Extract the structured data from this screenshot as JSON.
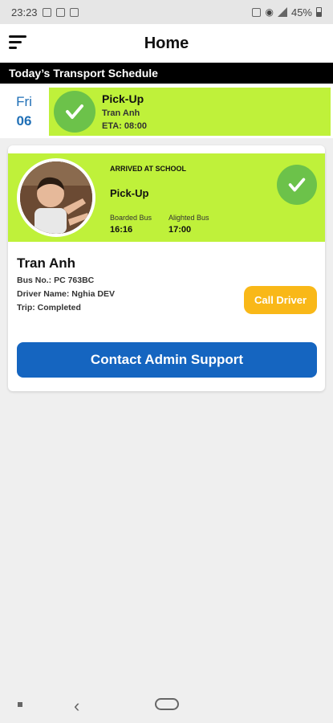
{
  "status_bar": {
    "time": "23:23",
    "battery": "45%"
  },
  "header": {
    "title": "Home",
    "menu_icon": "hamburger-menu-icon"
  },
  "schedule": {
    "heading": "Today’s Transport Schedule"
  },
  "day": {
    "name": "Fri",
    "number": "06",
    "event": {
      "title": "Pick-Up",
      "student": "Tran Anh",
      "eta": "ETA: 08:00",
      "icon": "check-icon"
    }
  },
  "card": {
    "status": "ARRIVED AT SCHOOL",
    "event_title": "Pick-Up",
    "boarded_label": "Boarded Bus",
    "boarded_time": "16:16",
    "alighted_label": "Alighted Bus",
    "alighted_time": "17:00",
    "student_name": "Tran Anh",
    "bus_no": "Bus No.: PC 763BC",
    "driver_name": "Driver Name: Nghia DEV",
    "trip": "Trip: Completed",
    "call_driver_label": "Call Driver",
    "contact_label": "Contact Admin Support"
  },
  "colors": {
    "accent_green": "#bff13a",
    "check_green": "#6cc24a",
    "day_blue": "#1f6fb6",
    "contact_blue": "#1565c0",
    "call_yellow": "#f9b818"
  }
}
